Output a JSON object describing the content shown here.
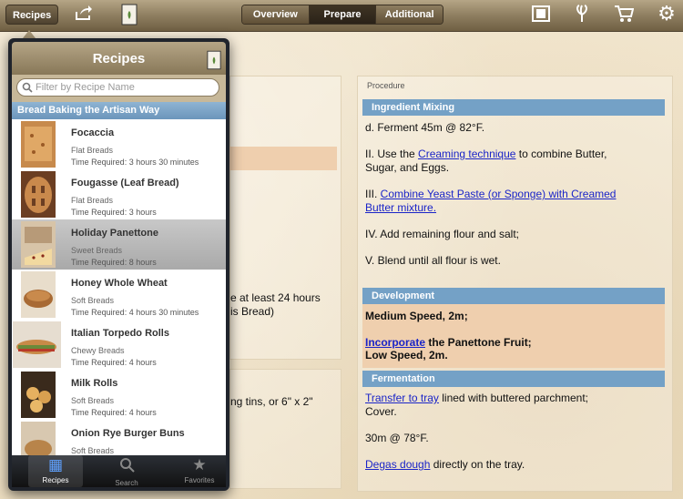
{
  "toolbar": {
    "recipes_button": "Recipes",
    "tabs": [
      {
        "label": "Overview"
      },
      {
        "label": "Prepare"
      },
      {
        "label": "Additional"
      }
    ]
  },
  "background": {
    "peek_text_1": "e at least 24 hours",
    "peek_text_2": "is Bread)",
    "peek_text_3": "ng tins, or 6\" x 2\""
  },
  "procedure": {
    "label": "Procedure",
    "sections": [
      {
        "title": "Ingredient Mixing"
      },
      {
        "title": "Development"
      },
      {
        "title": "Fermentation"
      }
    ],
    "mixing": {
      "line_d": "d. Ferment 45m @ 82°F.",
      "line_ii_pre": "II. Use the ",
      "line_ii_link": "Creaming technique",
      "line_ii_post": " to combine Butter,",
      "line_ii_2": "Sugar, and Eggs.",
      "line_iii_pre": "III. ",
      "line_iii_link": "Combine Yeast Paste (or Sponge) with Creamed",
      "line_iii_link2": "Butter mixture.",
      "line_iv": "IV.  Add remaining flour and salt;",
      "line_v": "V.  Blend until all flour is wet."
    },
    "development": {
      "line1": "Medium Speed, 2m;",
      "line2_link": "Incorporate",
      "line2_post": " the Panettone Fruit;",
      "line3": "Low Speed, 2m."
    },
    "fermentation": {
      "line1_link": "Transfer to tray",
      "line1_post": " lined with buttered parchment;",
      "line1_2": "Cover.",
      "line2": "30m @ 78°F.",
      "line3_link": "Degas dough",
      "line3_post": " directly on the tray."
    }
  },
  "popover": {
    "title": "Recipes",
    "search_placeholder": "Filter by Recipe Name",
    "group": "Bread Baking the Artisan Way",
    "recipes": [
      {
        "name": "Focaccia",
        "category": "Flat Breads",
        "time": "Time Required: 3 hours 30 minutes"
      },
      {
        "name": "Fougasse (Leaf Bread)",
        "category": "Flat Breads",
        "time": "Time Required: 3 hours"
      },
      {
        "name": "Holiday Panettone",
        "category": "Sweet Breads",
        "time": "Time Required: 8 hours"
      },
      {
        "name": "Honey Whole Wheat",
        "category": "Soft Breads",
        "time": "Time Required: 4 hours 30 minutes"
      },
      {
        "name": "Italian Torpedo Rolls",
        "category": "Chewy Breads",
        "time": "Time Required: 4 hours"
      },
      {
        "name": "Milk Rolls",
        "category": "Soft Breads",
        "time": "Time Required: 4 hours"
      },
      {
        "name": "Onion Rye Burger Buns",
        "category": "Soft Breads",
        "time": ""
      }
    ],
    "tabs": [
      {
        "label": "Recipes"
      },
      {
        "label": "Search"
      },
      {
        "label": "Favorites"
      }
    ]
  },
  "colors": {
    "section_header": "#74a1c6",
    "link": "#1a24c8",
    "development_bg": "#efcfae"
  }
}
